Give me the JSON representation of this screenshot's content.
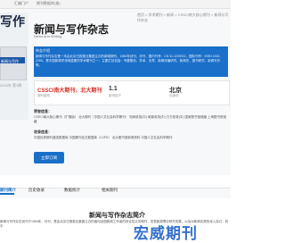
{
  "topbar": {
    "left_text": "汇编门户",
    "link_text": "期刊数据库(查)"
  },
  "breadcrumb": "首页 > 学术期刊 > 新闻 > CSSCI南大核心期刊 > 新闻与写作杂志",
  "cover": {
    "title": "写作",
    "caption": "新闻与写作",
    "text": "2024年 第1期"
  },
  "header": {
    "title": "新闻与写作杂志",
    "subtitle": "News and Writing"
  },
  "description": {
    "heading": "杂志介绍",
    "text": "新闻与写作杂志是一本由北京日报报业集团主办的新闻期刊，1984年创刊，月刊，国内刊号：CN 11-1225/G2，国际刊号：ISSN 1002-2295，是中国新闻学领域重要的学术期刊之一，主要栏目包括：专题策划、学术、业界、新闻传播研究、新闻史、报刊研究、新闻写作等。"
  },
  "stats": {
    "tag": "CSSCI南大期刊，北大期刊",
    "tag_sub": "期刊级别",
    "frequency": "1.1",
    "frequency_sub": "影响因子",
    "location": "北京",
    "location_sub": "出版地"
  },
  "sections": {
    "honor_h": "荣誉信息：",
    "honor_text": "CSSCI南大核心期刊（扩展版）  北大期刊（中国人文社会科学期刊） 知网收录(中) 维普收录(中) 万方收录(中) 国家图书馆馆藏 上海图书馆馆藏",
    "db_h": "收录信息：",
    "db_text": "中国优秀期刊遴选数据库  中国期刊全文数据库（CJFD）  北大图书馆新闻资料  中国人文社会科学期刊"
  },
  "button": {
    "label": "立即订阅"
  },
  "tabs": [
    "期刊简介",
    "历史收录",
    "数据统计",
    "相关期刊"
  ],
  "intro": {
    "heading": "新闻与写作杂志简介",
    "text": "新闻与写作杂志创刊于1984年，月刊，是由北京日报报业集团主办的面向全国新闻工作者的综合性业务期刊，发表新闻理论研究成果，以及对新闻实践的深入探讨，其中"
  },
  "watermark": "宏威期刊"
}
